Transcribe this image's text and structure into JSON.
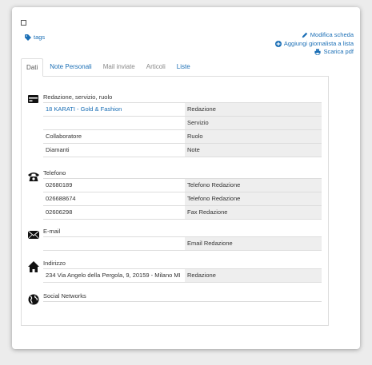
{
  "header": {
    "tags_label": "tags",
    "actions": [
      {
        "label": "Modifica scheda",
        "icon": "pencil-icon"
      },
      {
        "label": "Aggiungi giornalista a lista",
        "icon": "plus-circle-icon"
      },
      {
        "label": "Scarica pdf",
        "icon": "print-icon"
      }
    ]
  },
  "tabs": [
    {
      "label": "Dati",
      "active": true
    },
    {
      "label": "Note Personali",
      "active": false
    },
    {
      "label": "Mail inviate",
      "active": false
    },
    {
      "label": "Articoli",
      "active": false
    },
    {
      "label": "Liste",
      "active": false
    }
  ],
  "sections": {
    "role": {
      "title": "Redazione, servizio, ruolo",
      "icon": "id-card-icon",
      "rows": [
        {
          "value": "18 KARATI - Gold & Fashion",
          "label": "Redazione"
        },
        {
          "value": "",
          "label": "Servizio"
        },
        {
          "value": "Collaboratore",
          "label": "Ruolo"
        },
        {
          "value": "Diamanti",
          "label": "Note"
        }
      ]
    },
    "phone": {
      "title": "Telefono",
      "icon": "telephone-icon",
      "rows": [
        {
          "value": "02680189",
          "label": "Telefono Redazione"
        },
        {
          "value": "026688674",
          "label": "Telefono Redazione"
        },
        {
          "value": "02606298",
          "label": "Fax Redazione"
        }
      ]
    },
    "email": {
      "title": "E-mail",
      "icon": "envelope-icon",
      "rows": [
        {
          "value": "",
          "label": "Email Redazione"
        }
      ]
    },
    "address": {
      "title": "Indirizzo",
      "icon": "home-icon",
      "rows": [
        {
          "value": "234 Via Angelo della Pergola, 9, 20159 - Milano MI",
          "label": "Redazione"
        }
      ]
    },
    "social": {
      "title": "Social Networks",
      "icon": "globe-icon",
      "rows": []
    }
  }
}
